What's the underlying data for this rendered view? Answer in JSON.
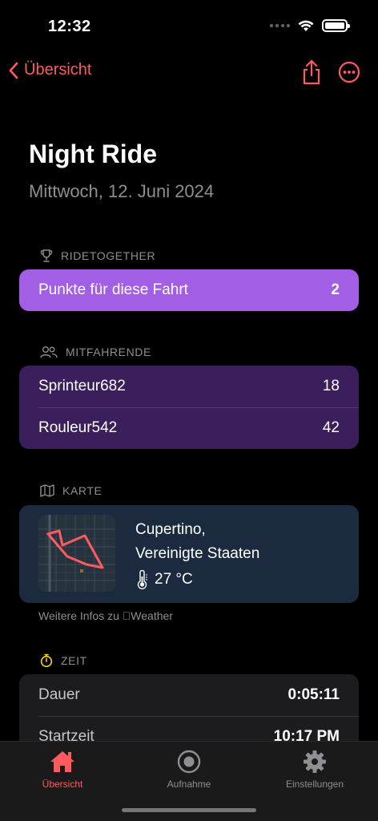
{
  "status": {
    "time": "12:32"
  },
  "nav": {
    "back_label": "Übersicht"
  },
  "header": {
    "title": "Night Ride",
    "date": "Mittwoch, 12. Juni 2024"
  },
  "ridetogether": {
    "heading": "RIDETOGETHER",
    "label": "Punkte für diese Fahrt",
    "value": "2"
  },
  "mitfahrende": {
    "heading": "MITFAHRENDE",
    "riders": [
      {
        "name": "Sprinteur682",
        "value": "18"
      },
      {
        "name": "Rouleur542",
        "value": "42"
      }
    ]
  },
  "karte": {
    "heading": "KARTE",
    "city": "Cupertino,",
    "country": "Vereinigte Staaten",
    "temperature": "27 °C",
    "weather_link": "Weitere Infos zu Weather"
  },
  "zeit": {
    "heading": "ZEIT",
    "rows": [
      {
        "label": "Dauer",
        "value": "0:05:11"
      },
      {
        "label": "Startzeit",
        "value": "10:17 PM"
      }
    ]
  },
  "tabs": [
    {
      "label": "Übersicht",
      "icon": "house-icon",
      "active": true
    },
    {
      "label": "Aufnahme",
      "icon": "record-icon",
      "active": false
    },
    {
      "label": "Einstellungen",
      "icon": "gear-icon",
      "active": false
    }
  ],
  "colors": {
    "accent": "#ff5a5f",
    "points_bg": "#a25fe6",
    "riders_bg": "#3a1f5c",
    "map_bg": "#1c2a3f",
    "zeit_icon": "#ffd60a"
  }
}
